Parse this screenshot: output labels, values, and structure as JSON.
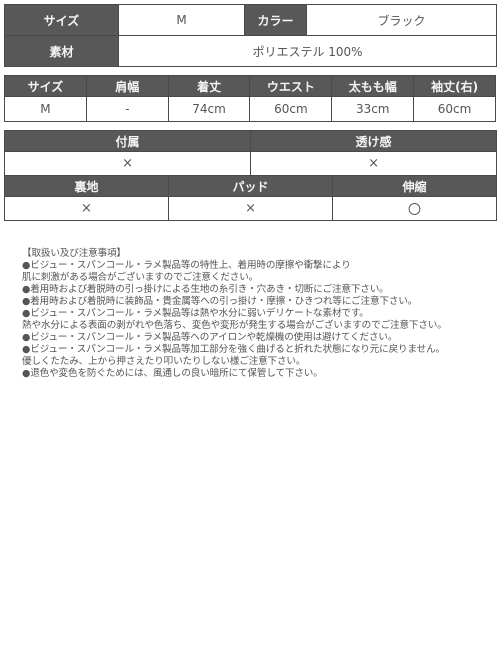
{
  "table1": {
    "size_label": "サイズ",
    "size_value": "M",
    "color_label": "カラー",
    "color_value": "ブラック",
    "material_label": "素材",
    "material_value": "ポリエステル 100%"
  },
  "table2": {
    "headers": [
      "サイズ",
      "肩幅",
      "着丈",
      "ウエスト",
      "太もも幅",
      "袖丈(右)"
    ],
    "rows": [
      [
        "M",
        "-",
        "74cm",
        "60cm",
        "33cm",
        "60cm"
      ]
    ]
  },
  "table3": {
    "row1_headers": [
      "付属",
      "透け感"
    ],
    "row1_values": [
      "×",
      "×"
    ],
    "row2_headers": [
      "裏地",
      "パッド",
      "伸縮"
    ],
    "row2_values": [
      "×",
      "×",
      "〇"
    ]
  },
  "notes": {
    "title": "【取扱い及び注意事項】",
    "lines": [
      "●ビジュー・スパンコール・ラメ製品等の特性上、着用時の摩擦や衝撃により",
      "肌に刺激がある場合がございますのでご注意ください。",
      "●着用時および着脱時の引っ掛けによる生地の糸引き・穴あき・切断にご注意下さい。",
      "●着用時および着脱時に装飾品・貴金属等への引っ掛け・摩擦・ひきつれ等にご注意下さい。",
      "●ビジュー・スパンコール・ラメ製品等は熱や水分に弱いデリケートな素材です。",
      "熱や水分による表面の剥がれや色落ち、変色や変形が発生する場合がございますのでご注意下さい。",
      "●ビジュー・スパンコール・ラメ製品等へのアイロンや乾燥機の使用は避けてください。",
      "●ビジュー・スパンコール・ラメ製品等加工部分を強く曲げると折れた状態になり元に戻りません。",
      "優しくたたみ、上から押さえたり叩いたりしない様ご注意下さい。",
      "●退色や変色を防ぐためには、風通しの良い暗所にて保管して下さい。"
    ]
  }
}
